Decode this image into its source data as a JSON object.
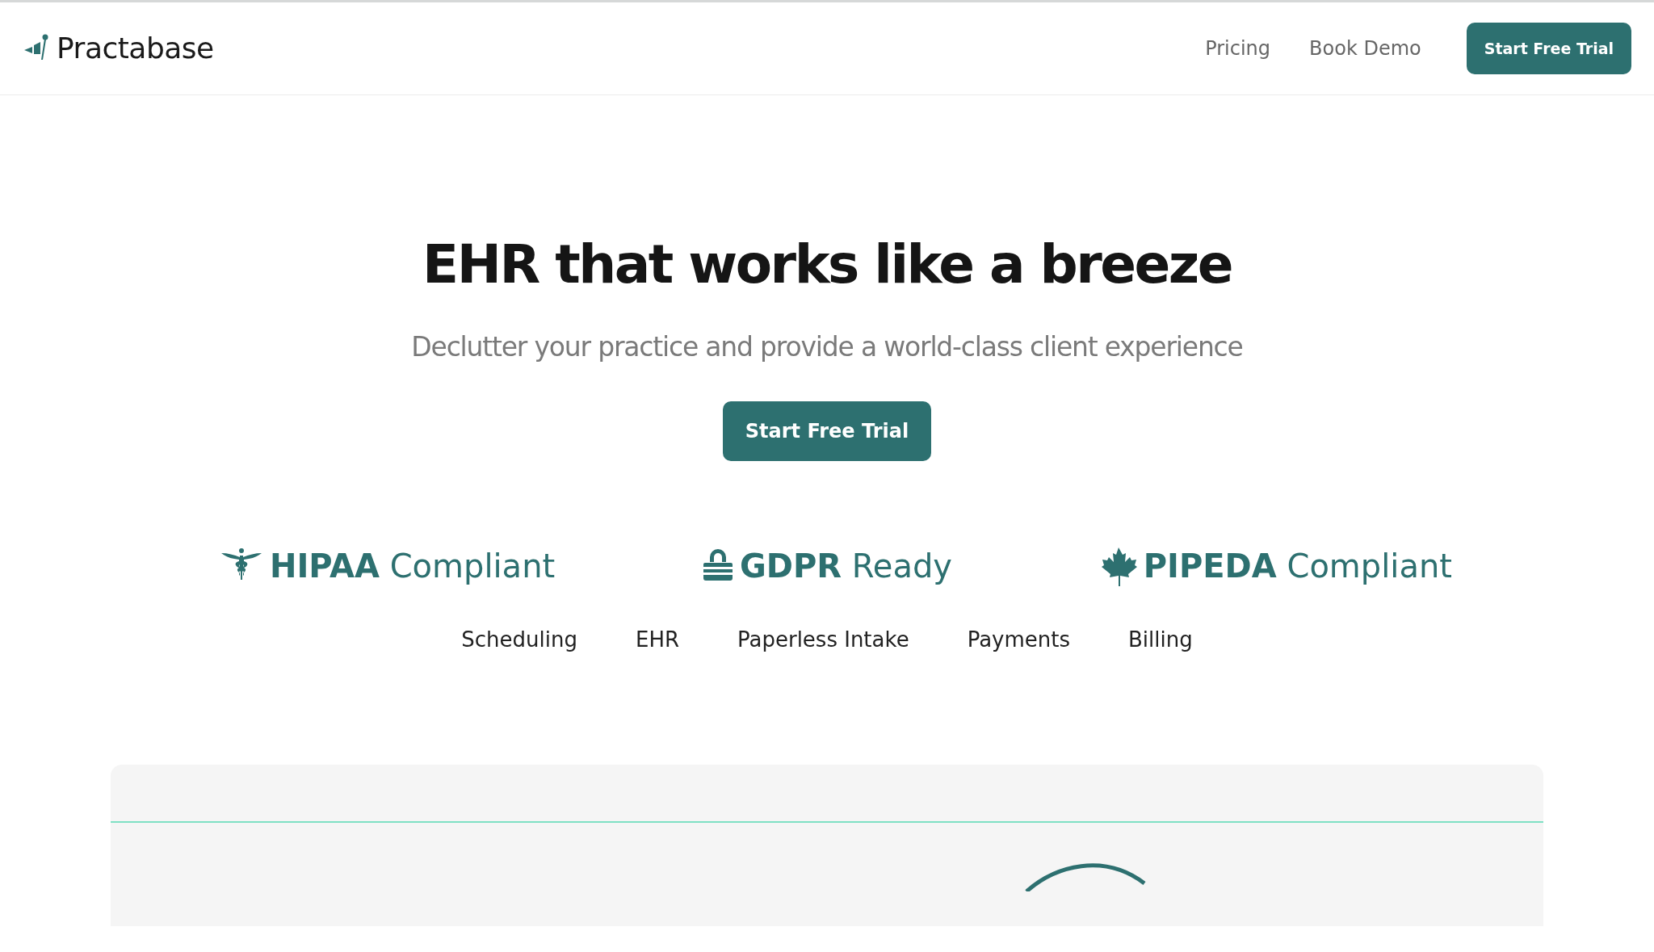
{
  "header": {
    "brand": "Practabase",
    "nav_links": [
      "Pricing",
      "Book Demo"
    ],
    "cta": "Start Free Trial"
  },
  "hero": {
    "title": "EHR that works like a breeze",
    "subtitle": "Declutter your practice and provide a world-class client experience",
    "cta": "Start Free Trial"
  },
  "badges": [
    {
      "kind": "caduceus",
      "strong": "HIPAA",
      "text": "Compliant"
    },
    {
      "kind": "lock",
      "strong": "GDPR",
      "text": "Ready"
    },
    {
      "kind": "maple",
      "strong": "PIPEDA",
      "text": "Compliant"
    }
  ],
  "features": [
    "Scheduling",
    "EHR",
    "Paperless Intake",
    "Payments",
    "Billing"
  ]
}
